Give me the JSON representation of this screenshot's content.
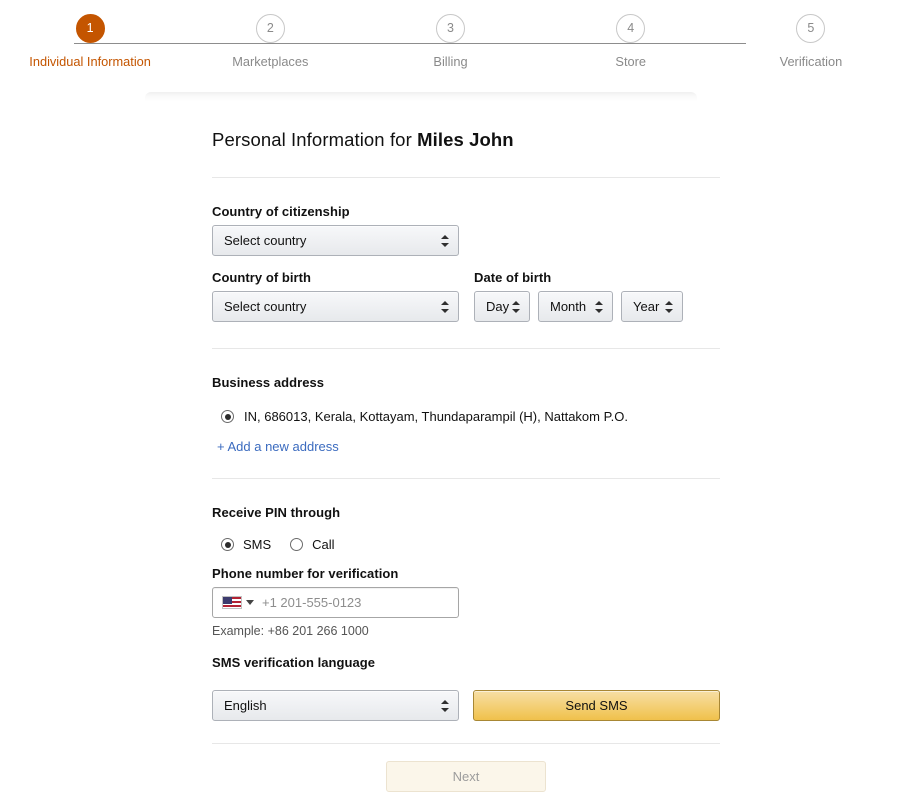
{
  "stepper": {
    "steps": [
      {
        "number": "1",
        "label": "Individual Information",
        "active": true
      },
      {
        "number": "2",
        "label": "Marketplaces",
        "active": false
      },
      {
        "number": "3",
        "label": "Billing",
        "active": false
      },
      {
        "number": "4",
        "label": "Store",
        "active": false
      },
      {
        "number": "5",
        "label": "Verification",
        "active": false
      }
    ],
    "active_color": "#c45500",
    "inactive_color": "#8a8a8a"
  },
  "page": {
    "title_prefix": "Personal Information for ",
    "title_name": "Miles John"
  },
  "citizenship": {
    "label": "Country of citizenship",
    "value": "Select country"
  },
  "birth_country": {
    "label": "Country of birth",
    "value": "Select country"
  },
  "date_of_birth": {
    "label": "Date of birth",
    "day": "Day",
    "month": "Month",
    "year": "Year"
  },
  "business_address": {
    "label": "Business address",
    "selected_address": "IN, 686013, Kerala, Kottayam, Thundaparampil (H), Nattakom P.O.",
    "add_link": "+ Add a new address"
  },
  "receive_pin": {
    "label": "Receive PIN through",
    "options": [
      {
        "label": "SMS",
        "checked": true
      },
      {
        "label": "Call",
        "checked": false
      }
    ]
  },
  "phone": {
    "label": "Phone number for verification",
    "country_flag": "us-flag-icon",
    "placeholder": "+1 201-555-0123",
    "value": "",
    "hint": "Example: +86 201 266 1000"
  },
  "sms_language": {
    "label": "SMS verification language",
    "value": "English"
  },
  "actions": {
    "send_sms_label": "Send SMS",
    "send_sms_color": "#f0c14b",
    "next_label": "Next",
    "next_disabled": true
  }
}
